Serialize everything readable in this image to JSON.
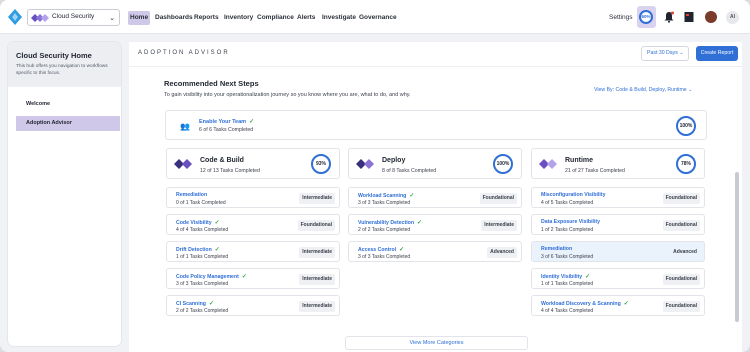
{
  "topbar": {
    "context": "Cloud Security",
    "nav": [
      {
        "label": "Home",
        "active": true
      },
      {
        "label": "Dashboards",
        "active": false
      },
      {
        "label": "Reports",
        "active": false
      },
      {
        "label": "Inventory",
        "active": false
      },
      {
        "label": "Compliance",
        "active": false
      },
      {
        "label": "Alerts",
        "active": false
      },
      {
        "label": "Investigate",
        "active": false
      },
      {
        "label": "Governance",
        "active": false
      }
    ],
    "settings": "Settings",
    "progress": "60%",
    "ai": "AI",
    "icons": [
      "logo-icon",
      "bell-icon",
      "book-icon",
      "grid-icon",
      "avatar"
    ]
  },
  "sidebar": {
    "title": "Cloud Security Home",
    "description": "This hub offers you navigation to workflows specific to this focus.",
    "items": [
      {
        "label": "Welcome",
        "selected": false
      },
      {
        "label": "Adoption Advisor",
        "selected": true
      }
    ]
  },
  "main": {
    "heading": "ADOPTION ADVISOR",
    "range": "Past 30 Days",
    "create_label": "Create Report",
    "rec_title": "Recommended Next Steps",
    "rec_sub": "To gain visibility into your operationalization journey so you know where you are, what to do, and why.",
    "view_by": "View By: Code & Build, Deploy, Runtime",
    "team": {
      "title": "Enable Your Team",
      "sub": "6 of 6 Tasks Completed",
      "pct": "100%"
    },
    "categories": [
      {
        "title": "Code & Build",
        "sub": "12 of 13 Tasks Completed",
        "pct": "93%"
      },
      {
        "title": "Deploy",
        "sub": "8 of 8 Tasks Completed",
        "pct": "100%"
      },
      {
        "title": "Runtime",
        "sub": "21 of 27 Tasks Completed",
        "pct": "78%"
      }
    ],
    "tasks": [
      [
        {
          "title": "Remediation",
          "sub": "0 of 1 Task Completed",
          "level": "Intermediate",
          "done": false
        },
        {
          "title": "Code Visibility",
          "sub": "4 of 4 Tasks Completed",
          "level": "Foundational",
          "done": true
        },
        {
          "title": "Drift Detection",
          "sub": "1 of 1 Tasks Completed",
          "level": "Intermediate",
          "done": true
        },
        {
          "title": "Code Policy Management",
          "sub": "3 of 3 Tasks Completed",
          "level": "Intermediate",
          "done": true
        },
        {
          "title": "CI Scanning",
          "sub": "2 of 2 Tasks Completed",
          "level": "Intermediate",
          "done": true
        }
      ],
      [
        {
          "title": "Workload Scanning",
          "sub": "3 of 3 Tasks Completed",
          "level": "Foundational",
          "done": true
        },
        {
          "title": "Vulnerability Detection",
          "sub": "2 of 2 Tasks Completed",
          "level": "Intermediate",
          "done": true
        },
        {
          "title": "Access Control",
          "sub": "3 of 3 Tasks Completed",
          "level": "Advanced",
          "done": true
        }
      ],
      [
        {
          "title": "Misconfiguration Visibility",
          "sub": "4 of 5 Tasks Completed",
          "level": "Foundational",
          "done": false
        },
        {
          "title": "Data Exposure Visibility",
          "sub": "1 of 2 Tasks Completed",
          "level": "Foundational",
          "done": false
        },
        {
          "title": "Remediation",
          "sub": "3 of 6 Tasks Completed",
          "level": "Advanced",
          "done": false,
          "highlight": true
        },
        {
          "title": "Identity Visibility",
          "sub": "1 of 1 Tasks Completed",
          "level": "Foundational",
          "done": true
        },
        {
          "title": "Workload Discovery & Scanning",
          "sub": "4 of 4 Tasks Completed",
          "level": "Foundational",
          "done": true
        }
      ]
    ],
    "more_label": "View More Categories"
  },
  "colors": {
    "accent": "#2f6fd6",
    "selected": "#cfc8e8",
    "check": "#2fa24c"
  }
}
